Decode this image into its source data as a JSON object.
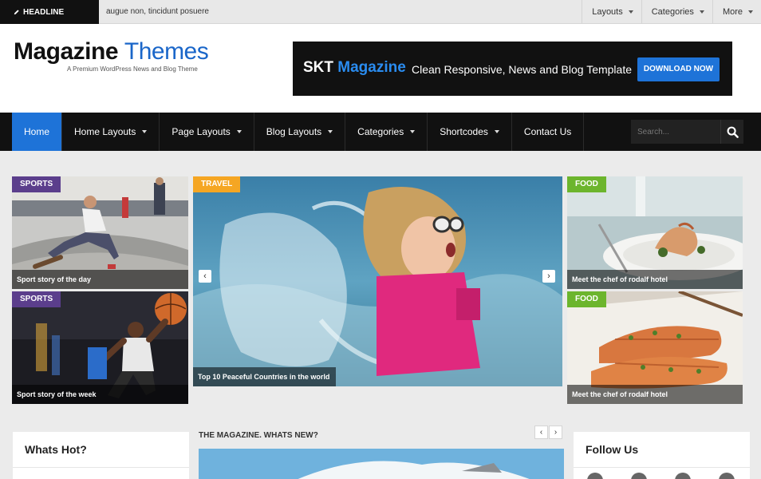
{
  "topbar": {
    "headline_label": "HEADLINE",
    "ticker_text": "augue non, tincidunt posuere",
    "menu": [
      {
        "label": "Layouts"
      },
      {
        "label": "Categories"
      },
      {
        "label": "More"
      }
    ]
  },
  "header": {
    "logo_bold": "Magazine",
    "logo_thin": "Themes",
    "tagline": "A Premium WordPress News and Blog Theme",
    "banner": {
      "brand_a": "SKT",
      "brand_b": "Magazine",
      "text": "Clean Responsive, News and Blog Template",
      "button": "DOWNLOAD NOW"
    }
  },
  "nav": {
    "items": [
      {
        "label": "Home"
      },
      {
        "label": "Home Layouts"
      },
      {
        "label": "Page Layouts"
      },
      {
        "label": "Blog Layouts"
      },
      {
        "label": "Categories"
      },
      {
        "label": "Shortcodes"
      },
      {
        "label": "Contact Us"
      }
    ],
    "search_placeholder": "Search...",
    "accent": "#1e73d8"
  },
  "featured": {
    "tiles": [
      {
        "category": "SPORTS",
        "caption": "Sport story of the day",
        "cat_color": "#5b3e8c"
      },
      {
        "category": "SPORTS",
        "caption": "Sport story of the week",
        "cat_color": "#5b3e8c"
      },
      {
        "category": "TRAVEL",
        "caption": "Top 10 Peaceful Countries in the world",
        "cat_color": "#f5a623"
      },
      {
        "category": "FOOD",
        "caption": "Meet the chef of rodalf hotel",
        "cat_color": "#6cb52d"
      },
      {
        "category": "FOOD",
        "caption": "Meet the chef of rodalf hotel",
        "cat_color": "#6cb52d"
      }
    ],
    "prev_arrow": "‹",
    "next_arrow": "›"
  },
  "lower": {
    "whats_hot": "Whats Hot?",
    "magazine_title": "THE MAGAZINE. WHATS NEW?",
    "follow_us": "Follow Us",
    "prev_arrow": "‹",
    "next_arrow": "›"
  }
}
